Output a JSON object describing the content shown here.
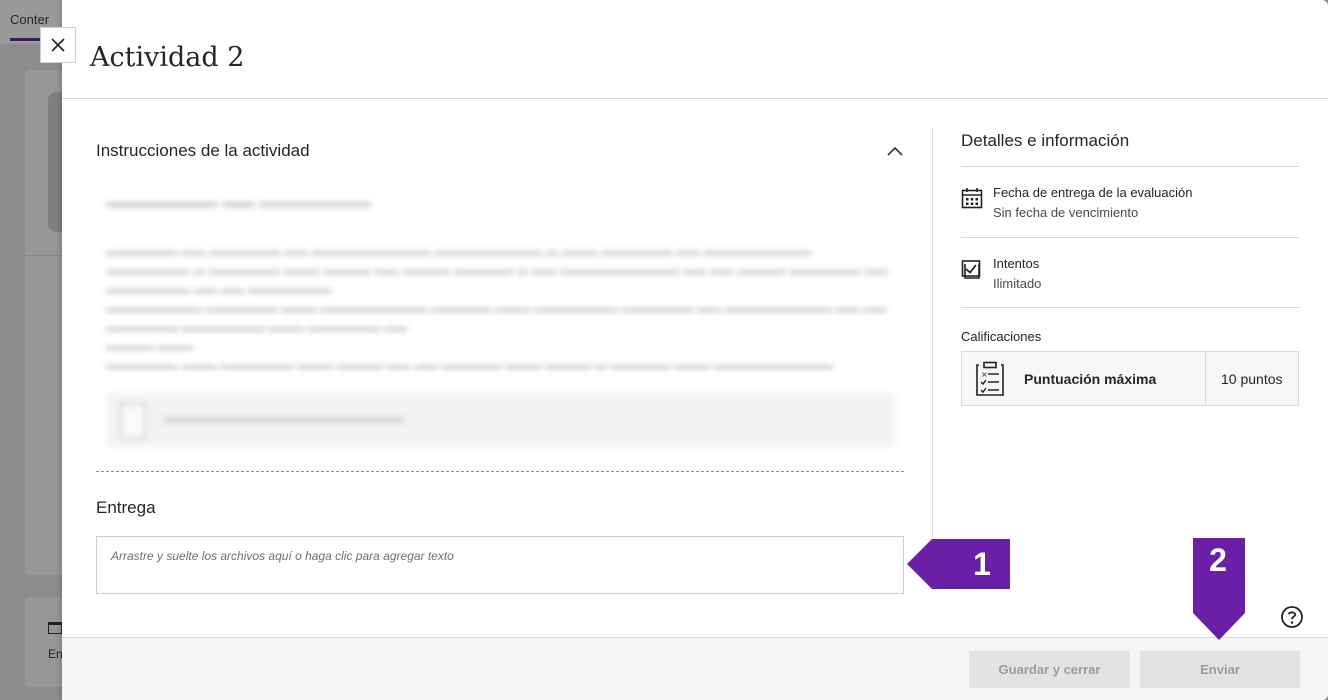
{
  "background": {
    "tab_label": "Conter",
    "card_label": "En"
  },
  "panel": {
    "title": "Actividad 2",
    "close_label": "×"
  },
  "instructions": {
    "heading": "Instrucciones de la actividad",
    "collapse_icon": "chevron-up-icon"
  },
  "submission": {
    "heading": "Entrega",
    "placeholder": "Arrastre y suelte los archivos aquí o haga clic para agregar texto"
  },
  "details": {
    "heading": "Detalles e información",
    "due_date": {
      "icon": "calendar-icon",
      "title": "Fecha de entrega de la evaluación",
      "value": "Sin fecha de vencimiento"
    },
    "attempts": {
      "icon": "checkbox-icon",
      "title": "Intentos",
      "value": "Ilimitado"
    },
    "grading": {
      "label": "Calificaciones",
      "icon": "rubric-checklist-icon",
      "max_label": "Puntuación máxima",
      "max_value": "10 puntos"
    }
  },
  "footer": {
    "save_label": "Guardar y cerrar",
    "send_label": "Enviar"
  },
  "help_icon": "help-circle-icon",
  "callouts": {
    "first": "1",
    "second": "2",
    "color": "#6b1fa6"
  },
  "colors": {
    "accent": "#6b1fa6",
    "disabled_button_bg": "#e3e3e3",
    "disabled_button_text": "#9b9b9b"
  }
}
